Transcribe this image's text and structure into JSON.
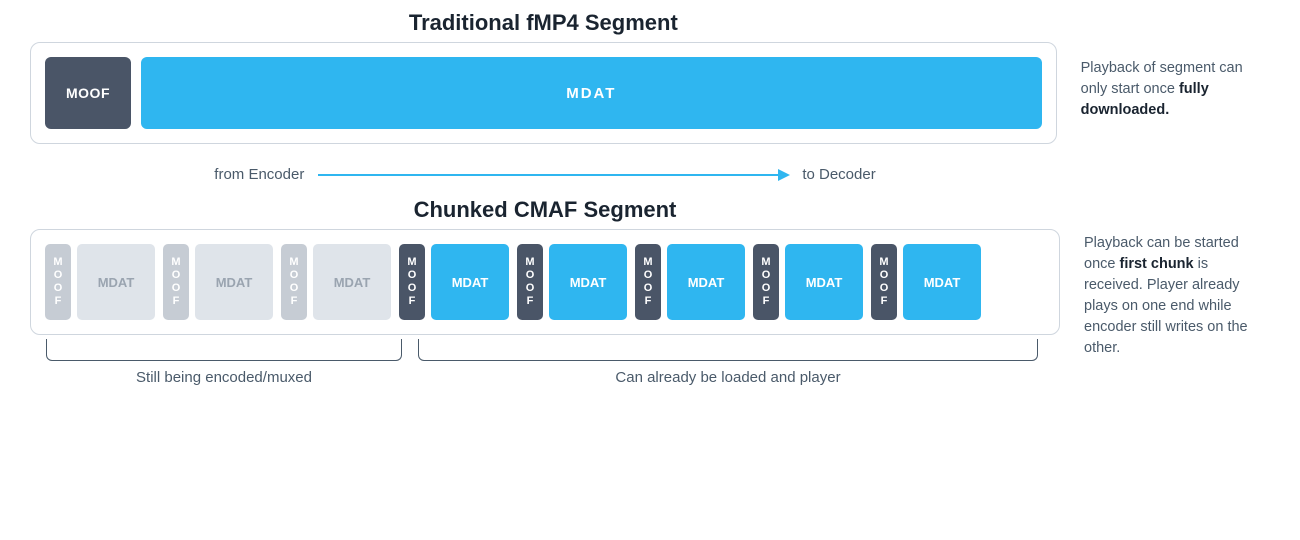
{
  "traditional": {
    "title": "Traditional fMP4 Segment",
    "moof": "MOOF",
    "mdat": "MDAT",
    "caption_pre": "Playback of segment can only start once ",
    "caption_bold": "fully downloaded."
  },
  "flow": {
    "from": "from Encoder",
    "to": "to Decoder"
  },
  "chunked": {
    "title": "Chunked CMAF Segment",
    "moof": "MOOF",
    "mdat": "MDAT",
    "caption_pre": "Playback can be started once ",
    "caption_bold": "first chunk",
    "caption_post": " is received. Player already plays on one end while encoder still writes on the other."
  },
  "brackets": {
    "encoding": "Still being encoded/muxed",
    "loaded": "Can already be loaded and player"
  }
}
